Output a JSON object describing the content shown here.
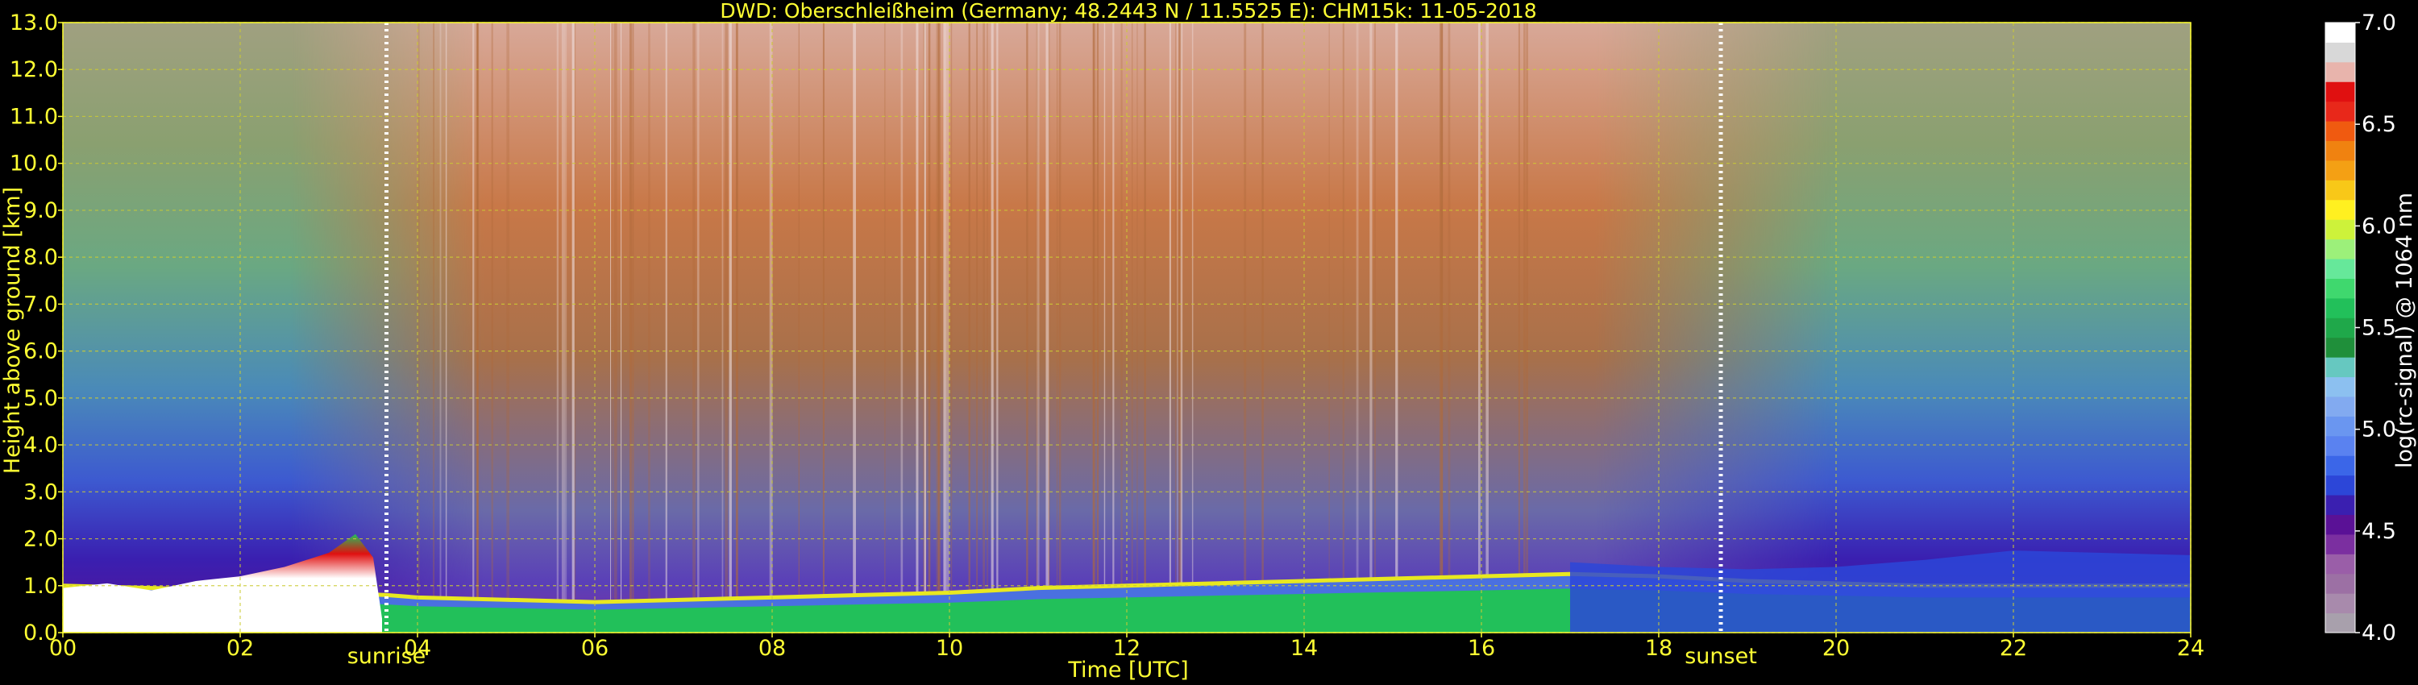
{
  "chart_data": {
    "type": "heatmap",
    "title": "DWD: Oberschleißheim (Germany; 48.2443 N / 11.5525 E):    CHM15k: 11-05-2018",
    "xlabel": "Time [UTC]",
    "ylabel": "Height above ground [km]",
    "xlim": [
      0,
      24
    ],
    "ylim": [
      0.0,
      13.0
    ],
    "x_ticks": [
      "00",
      "02",
      "04",
      "06",
      "08",
      "10",
      "12",
      "14",
      "16",
      "18",
      "20",
      "22",
      "24"
    ],
    "y_ticks": [
      "0.0",
      "1.0",
      "2.0",
      "3.0",
      "4.0",
      "5.0",
      "6.0",
      "7.0",
      "8.0",
      "9.0",
      "10.0",
      "11.0",
      "12.0",
      "13.0"
    ],
    "grid": true,
    "annotations": [
      {
        "label": "sunrise",
        "x": 3.65
      },
      {
        "label": "sunset",
        "x": 18.7
      }
    ],
    "colorbar": {
      "label": "log(rc-signal) @ 1064 nm",
      "range": [
        4.0,
        7.0
      ],
      "ticks": [
        "4.0",
        "4.5",
        "5.0",
        "5.5",
        "6.0",
        "6.5",
        "7.0"
      ],
      "levels": [
        "#a8a0ac",
        "#a88aac",
        "#9c70a4",
        "#9a5ea8",
        "#7b2fa0",
        "#5a1196",
        "#3a1fb0",
        "#2c46d8",
        "#3b66e8",
        "#5a82f0",
        "#6a96f0",
        "#82aaf0",
        "#8cc0f0",
        "#66c8c0",
        "#1f8f3a",
        "#1fa84a",
        "#22c05a",
        "#3fd86e",
        "#66e89a",
        "#9cf07a",
        "#cdf23a",
        "#fff020",
        "#f8c818",
        "#f4a014",
        "#f08210",
        "#f05a10",
        "#e8281a",
        "#e01010",
        "#e8b4ac",
        "#d8d8d8",
        "#ffffff"
      ]
    },
    "pbl_layer_top_km": [
      [
        0,
        1.0
      ],
      [
        1,
        0.95
      ],
      [
        2,
        0.9
      ],
      [
        3,
        0.85
      ],
      [
        3.65,
        0.8
      ],
      [
        4,
        0.75
      ],
      [
        5,
        0.7
      ],
      [
        6,
        0.65
      ],
      [
        7,
        0.7
      ],
      [
        8,
        0.75
      ],
      [
        9,
        0.8
      ],
      [
        10,
        0.85
      ],
      [
        11,
        0.95
      ],
      [
        12,
        1.0
      ],
      [
        13,
        1.05
      ],
      [
        14,
        1.1
      ],
      [
        15,
        1.15
      ],
      [
        16,
        1.2
      ],
      [
        17,
        1.25
      ],
      [
        18,
        1.2
      ],
      [
        19,
        1.1
      ],
      [
        20,
        1.05
      ],
      [
        21,
        1.0
      ],
      [
        22,
        1.0
      ],
      [
        23,
        1.0
      ],
      [
        24,
        1.0
      ]
    ],
    "residual_layer_top_km": [
      [
        17,
        1.5
      ],
      [
        18,
        1.4
      ],
      [
        19,
        1.35
      ],
      [
        20,
        1.4
      ],
      [
        21,
        1.55
      ],
      [
        22,
        1.75
      ],
      [
        23,
        1.7
      ],
      [
        24,
        1.65
      ]
    ]
  }
}
